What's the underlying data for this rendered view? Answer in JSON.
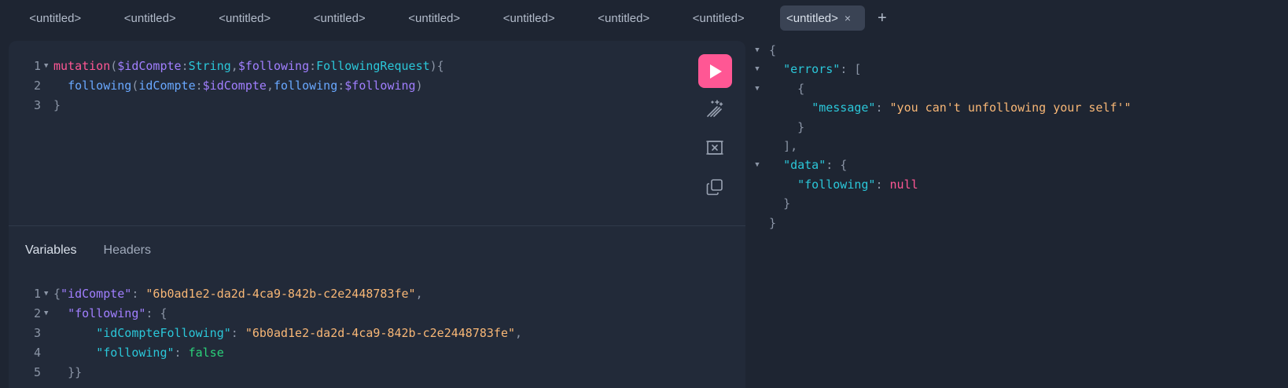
{
  "tabs": {
    "items": [
      "<untitled>",
      "<untitled>",
      "<untitled>",
      "<untitled>",
      "<untitled>",
      "<untitled>",
      "<untitled>",
      "<untitled>"
    ],
    "active": "<untitled>",
    "close_glyph": "×",
    "add_glyph": "+"
  },
  "editor": {
    "line_numbers": [
      "1",
      "2",
      "3"
    ],
    "line1": {
      "kw": "mutation",
      "p1": "(",
      "v1": "$idCompte",
      "c1": ":",
      "t1": "String",
      "comma": ",",
      "v2": "$following",
      "c2": ":",
      "t2": "FollowingRequest",
      "p2": "){"
    },
    "line2": {
      "fn": "following",
      "p1": "(",
      "a1": "idCompte",
      "c1": ":",
      "v1": "$idCompte",
      "comma": ",",
      "a2": "following",
      "c2": ":",
      "v2": "$following",
      "p2": ")"
    },
    "line3": {
      "p": "}"
    }
  },
  "toolbar": {
    "run": "play-icon",
    "prettify": "magic-wand-icon",
    "merge": "merge-fragments-icon",
    "copy": "copy-icon"
  },
  "variables_panel": {
    "tabs": [
      "Variables",
      "Headers"
    ],
    "line_numbers": [
      "1",
      "2",
      "3",
      "4",
      "5"
    ],
    "lines": {
      "l1_open": "{",
      "l1_key": "\"idCompte\"",
      "l1_colon": ": ",
      "l1_val": "\"6b0ad1e2-da2d-4ca9-842b-c2e2448783fe\"",
      "l1_comma": ",",
      "l2_key": "\"following\"",
      "l2_rest": ": {",
      "l3_key": "\"idCompteFollowing\"",
      "l3_colon": ": ",
      "l3_val": "\"6b0ad1e2-da2d-4ca9-842b-c2e2448783fe\"",
      "l3_comma": ",",
      "l4_key": "\"following\"",
      "l4_colon": ": ",
      "l4_val": "false",
      "l5": "}}"
    }
  },
  "result": {
    "l1": "{",
    "l2_key": "\"errors\"",
    "l2_rest": ": [",
    "l3": "{",
    "l4_key": "\"message\"",
    "l4_colon": ": ",
    "l4_val": "\"you can't unfollowing your self'\"",
    "l5": "}",
    "l6": "],",
    "l7_key": "\"data\"",
    "l7_rest": ": {",
    "l8_key": "\"following\"",
    "l8_colon": ": ",
    "l8_val": "null",
    "l9": "}",
    "l10": "}"
  },
  "colors": {
    "accent": "#ff5794",
    "background": "#1e2532",
    "panel": "#222a39"
  }
}
